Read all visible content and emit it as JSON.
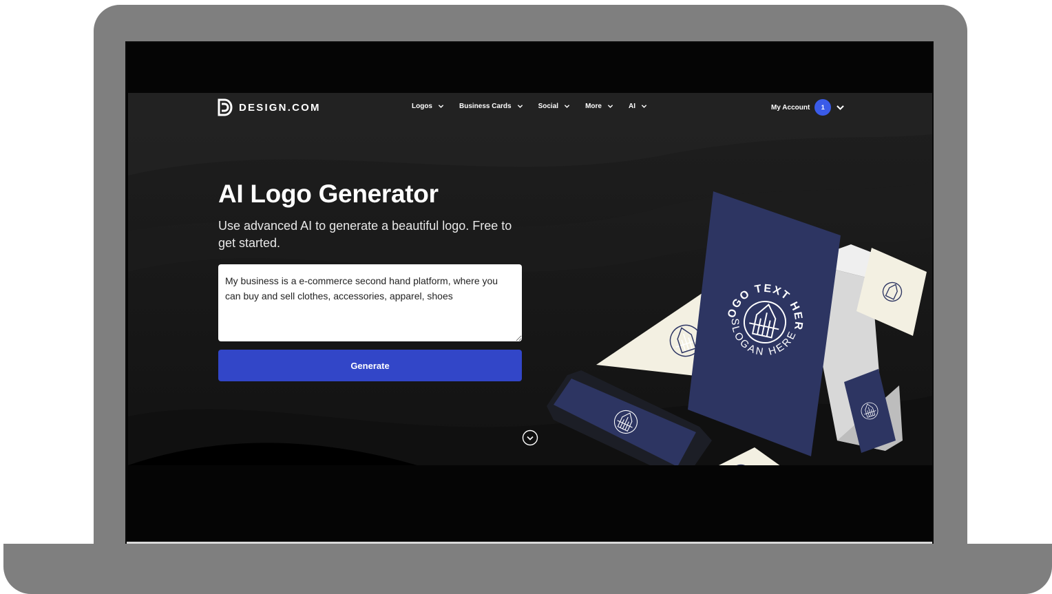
{
  "brand": {
    "name": "DESIGN.COM"
  },
  "nav": {
    "items": [
      {
        "label": "Logos"
      },
      {
        "label": "Business Cards"
      },
      {
        "label": "Social"
      },
      {
        "label": "More"
      },
      {
        "label": "AI"
      }
    ],
    "account_label": "My Account",
    "account_badge": "1"
  },
  "hero": {
    "title": "AI Logo Generator",
    "subtitle": "Use advanced AI to generate a beautiful logo. Free to get started.",
    "prompt_value": "My business is a e-commerce second hand platform, where you can buy and sell clothes, accessories, apparel, shoes",
    "generate_label": "Generate"
  },
  "mockup": {
    "logo_top_text": "LOGO TEXT HERE",
    "logo_bottom_text": "SLOGAN HERE"
  },
  "colors": {
    "page_bg": "#1b1b1b",
    "accent": "#3246c8",
    "badge": "#3a5be8",
    "navy_card": "#2d3562",
    "cream_card": "#f3f0e2"
  },
  "icons": {
    "brand_logo": "d-logo-icon",
    "dropdown": "chevron-down-icon",
    "scroll": "chevron-circle-down-icon"
  }
}
